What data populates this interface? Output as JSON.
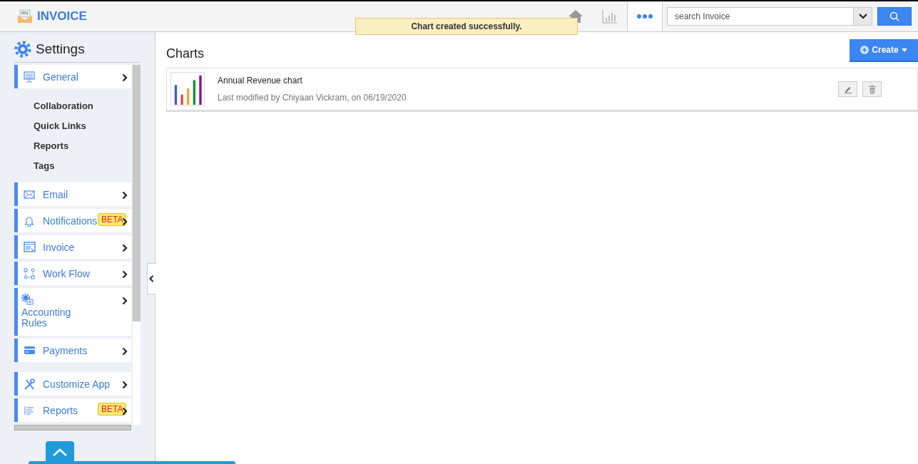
{
  "app": {
    "title": "INVOICE"
  },
  "toolbar": {
    "search": {
      "placeholder": "search Invoice"
    }
  },
  "toast": "Chart created successfully.",
  "sidebar": {
    "title": "Settings",
    "items": [
      {
        "label": "General",
        "children": [
          {
            "label": "Collaboration"
          },
          {
            "label": "Quick Links"
          },
          {
            "label": "Reports"
          },
          {
            "label": "Tags"
          }
        ]
      },
      {
        "label": "Email"
      },
      {
        "label": "Notifications",
        "badge": "BETA"
      },
      {
        "label": "Invoice"
      },
      {
        "label": "Work Flow"
      },
      {
        "label": "Accounting Rules"
      },
      {
        "label": "Payments"
      },
      {
        "label": "Customize App"
      },
      {
        "label": "Reports",
        "badge": "BETA"
      }
    ]
  },
  "content": {
    "title": "Charts",
    "create_button": "Create",
    "charts": [
      {
        "name": "Annual Revenue chart",
        "modified": "Last modified by Chiyaan Vickram, on 06/19/2020"
      }
    ]
  }
}
